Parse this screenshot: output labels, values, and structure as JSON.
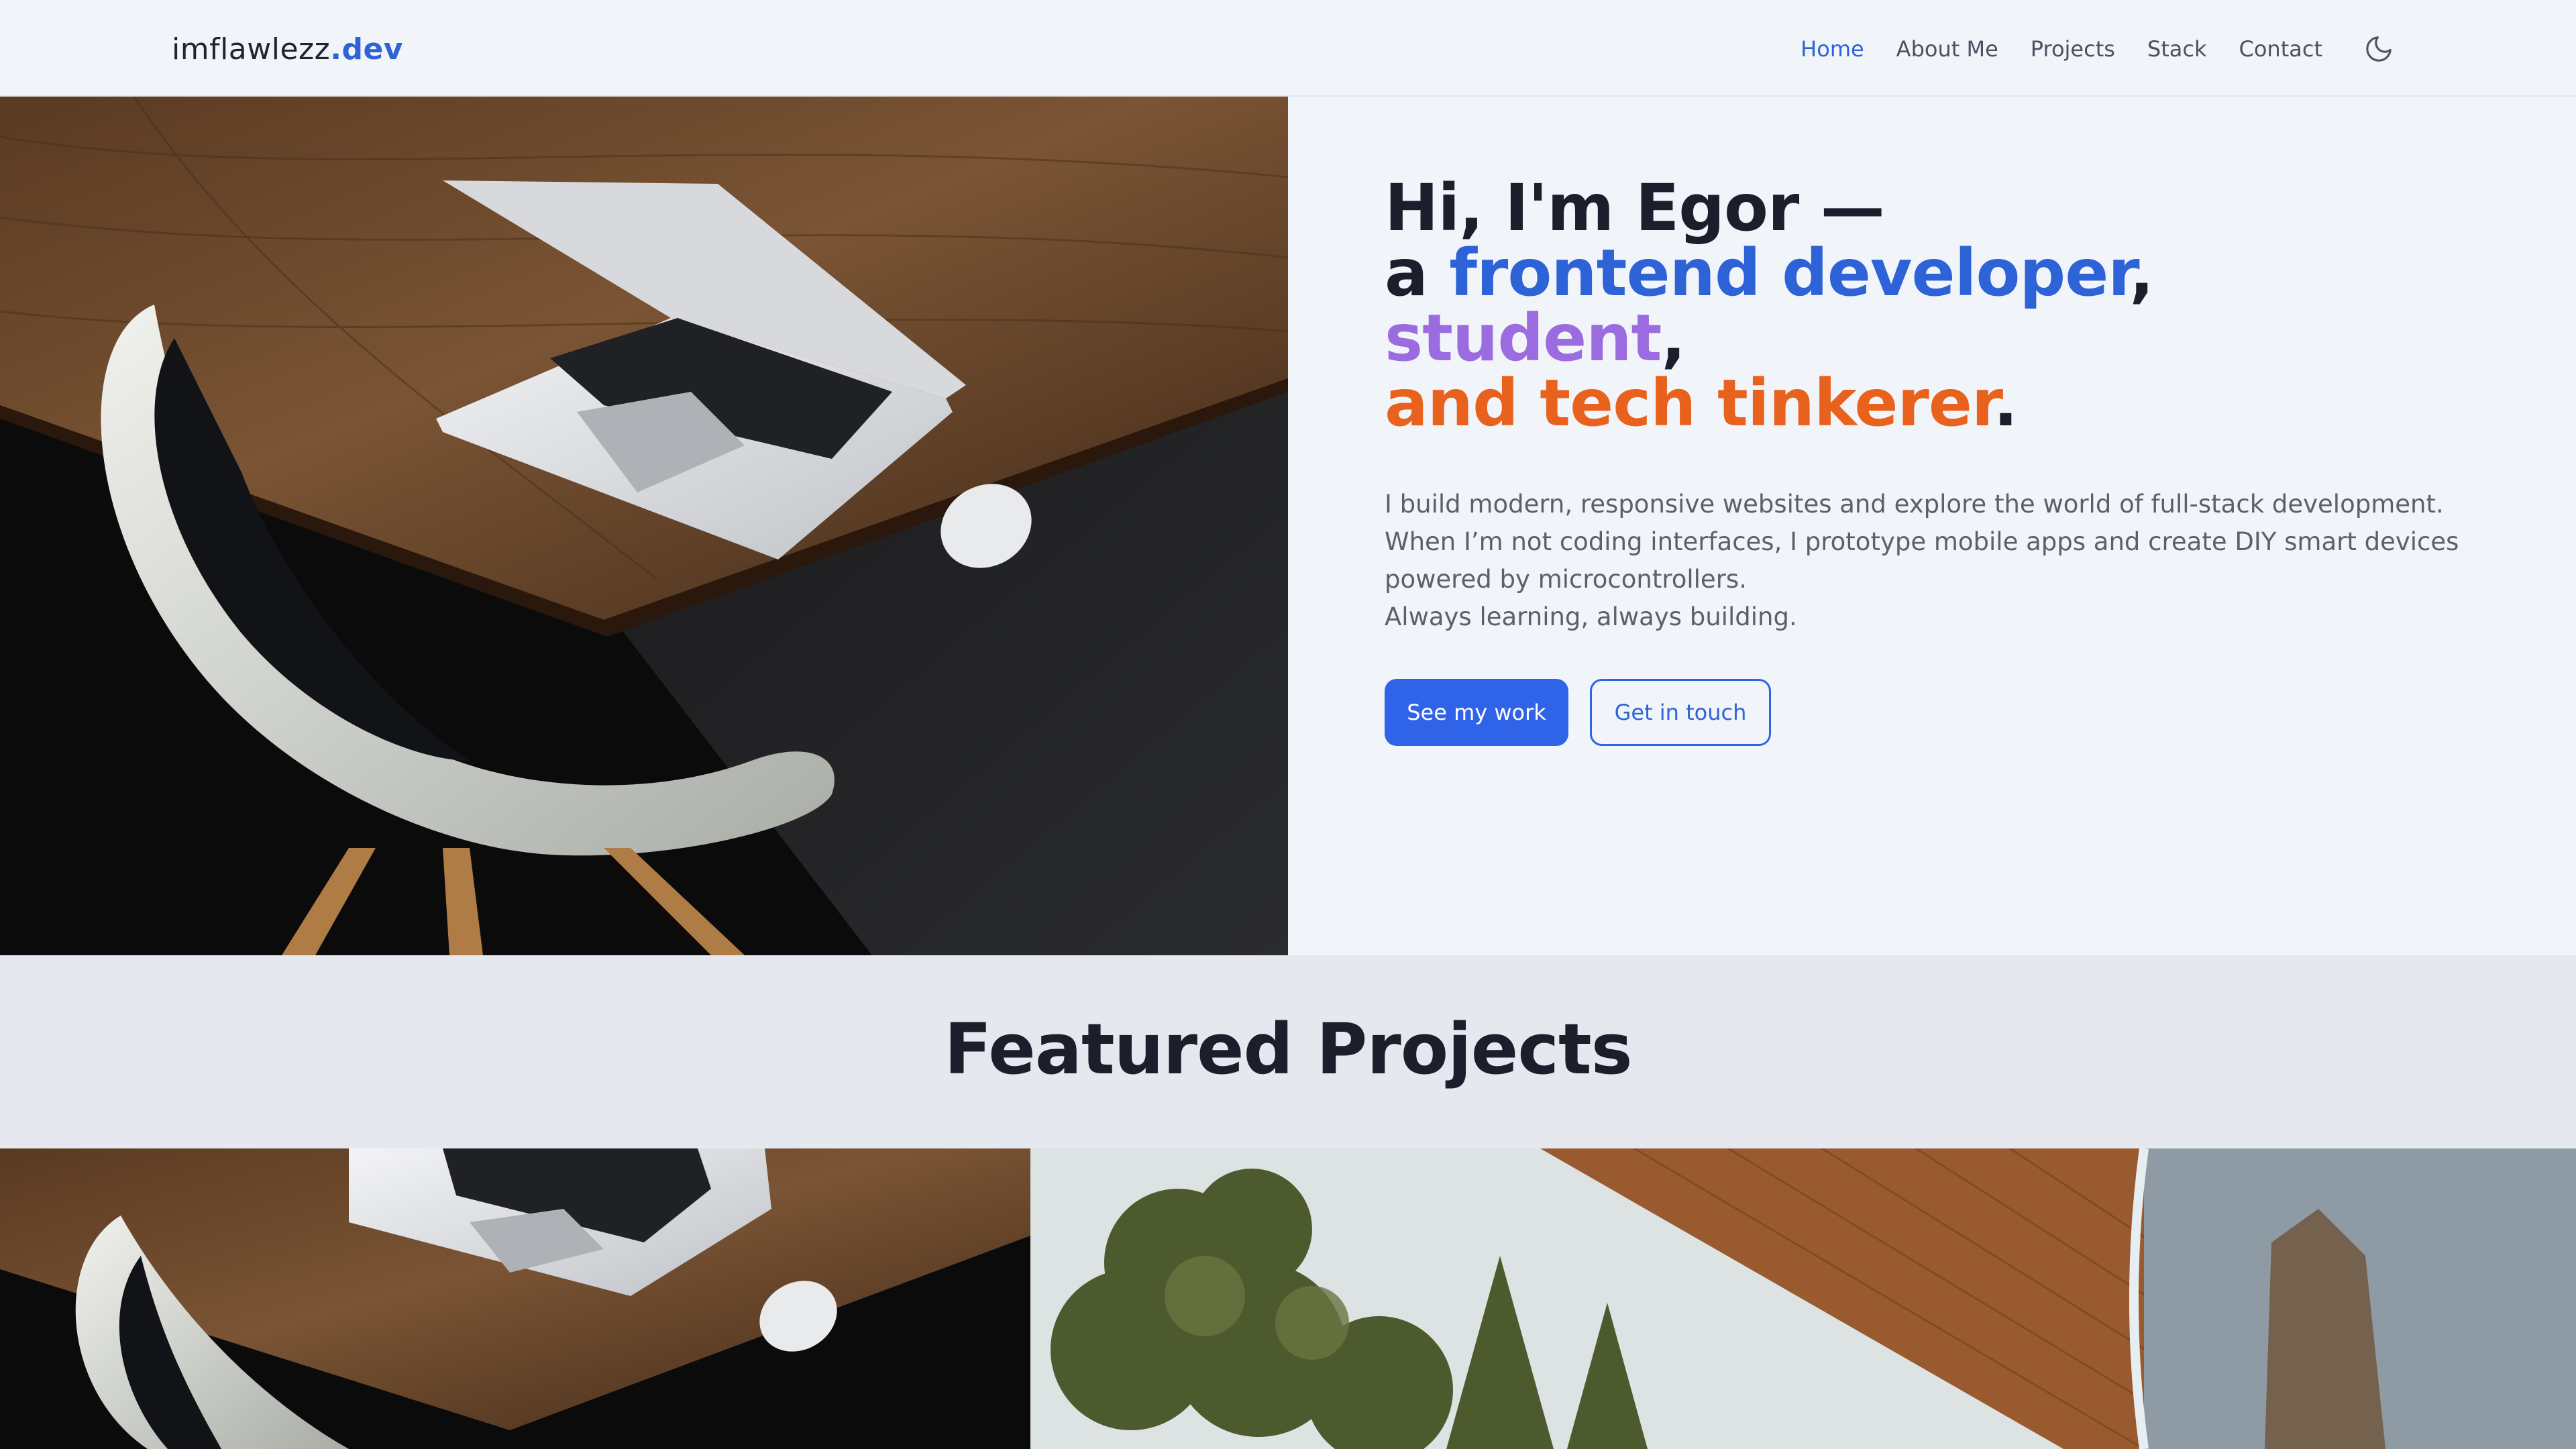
{
  "nav": {
    "brand_name": "imflawlezz",
    "brand_tld": ".dev",
    "links": [
      "Home",
      "About Me",
      "Projects",
      "Stack",
      "Contact"
    ],
    "active": "Home",
    "theme_icon": "moon-icon"
  },
  "hero": {
    "line1": "Hi, I'm Egor —",
    "line2_prefix": "a ",
    "role1": "frontend developer",
    "comma": ",",
    "role2": "student",
    "role3": "and tech tinkerer",
    "period": ".",
    "bio": [
      "I build modern, responsive websites and explore the world of full-stack development.",
      "When I’m not coding interfaces, I prototype mobile apps and create DIY smart devices",
      "powered by microcontrollers.",
      "Always learning, always building."
    ],
    "cta_primary": "See my work",
    "cta_secondary": "Get in touch"
  },
  "featured": {
    "title": "Featured Projects"
  },
  "colors": {
    "accent": "#2f64e8",
    "purple": "#9b6be0",
    "orange": "#e8621d",
    "background": "#f1f4f9"
  }
}
